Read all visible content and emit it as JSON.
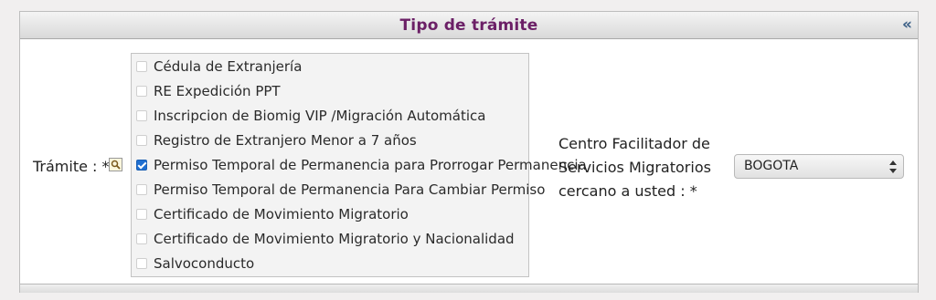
{
  "header": {
    "title": "Tipo de trámite",
    "collapse_glyph": "«"
  },
  "tramite": {
    "label": "Trámite : *",
    "options": [
      {
        "label": "Cédula de Extranjería",
        "checked": false
      },
      {
        "label": "RE Expedición PPT",
        "checked": false
      },
      {
        "label": "Inscripcion de Biomig VIP /Migración Automática",
        "checked": false
      },
      {
        "label": "Registro de Extranjero Menor a 7 años",
        "checked": false
      },
      {
        "label": "Permiso Temporal de Permanencia para Prorrogar Permanencia",
        "checked": true
      },
      {
        "label": "Permiso Temporal de Permanencia Para Cambiar Permiso",
        "checked": false
      },
      {
        "label": "Certificado de Movimiento Migratorio",
        "checked": false
      },
      {
        "label": "Certificado de Movimiento Migratorio y Nacionalidad",
        "checked": false
      },
      {
        "label": "Salvoconducto",
        "checked": false
      }
    ]
  },
  "centro": {
    "label_lines": [
      "Centro Facilitador de",
      "Servicios Migratorios",
      "cercano a usted : *"
    ],
    "selected": "BOGOTA"
  },
  "icons": {
    "lookup": "search-icon",
    "select": "updown-arrows-icon"
  },
  "colors": {
    "title": "#6b1f66",
    "check": "#1f6fd1",
    "collapse": "#3b5f86"
  }
}
